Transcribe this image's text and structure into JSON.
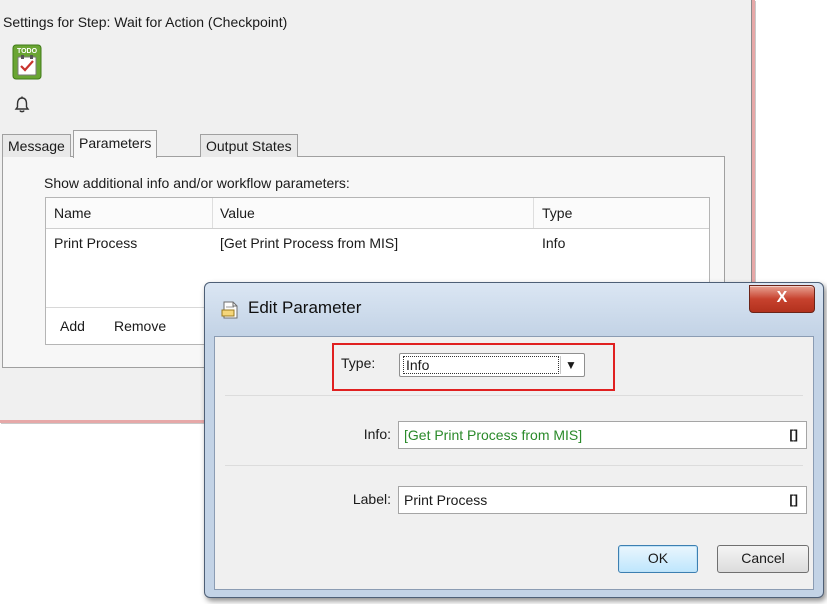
{
  "settings": {
    "title": "Settings for Step: Wait for Action (Checkpoint)",
    "todo_icon_text": "TODO",
    "tabs": [
      {
        "label": "Message"
      },
      {
        "label": "Parameters",
        "active": true
      },
      {
        "label": "Output States"
      }
    ],
    "params_caption": "Show additional info and/or workflow parameters:",
    "table": {
      "columns": [
        "Name",
        "Value",
        "Type"
      ],
      "rows": [
        {
          "name": "Print Process",
          "value": "[Get Print Process from MIS]",
          "type": "Info"
        }
      ],
      "actions": [
        "Add",
        "Remove"
      ]
    }
  },
  "dialog": {
    "title": "Edit Parameter",
    "close_label": "X",
    "type": {
      "label": "Type:",
      "value": "Info"
    },
    "info": {
      "label": "Info:",
      "value": "[Get Print Process from MIS]",
      "bracket": "[]"
    },
    "label_field": {
      "label": "Label:",
      "value": "Print Process",
      "bracket": "[]"
    },
    "ok_label": "OK",
    "cancel_label": "Cancel"
  },
  "colors": {
    "highlight_border": "#e02020",
    "info_value_text": "#2a8a2a",
    "close_button": "#c7422e",
    "window_frame": "#c3d3e6"
  },
  "icons": [
    "todo-checklist-icon",
    "bell-icon",
    "document-icon",
    "close-icon",
    "dropdown-arrow-icon"
  ]
}
